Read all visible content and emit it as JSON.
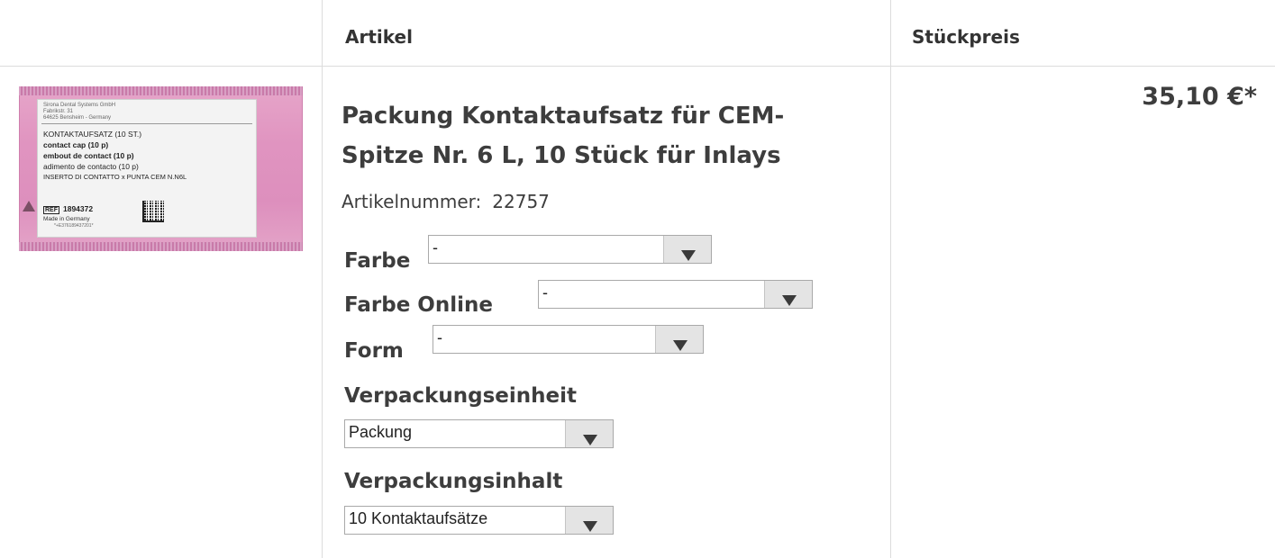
{
  "table": {
    "headers": {
      "article": "Artikel",
      "unit_price": "Stückpreis"
    }
  },
  "product": {
    "title": "Packung Kontaktaufsatz für CEM-Spitze Nr. 6 L, 10 Stück für Inlays",
    "article_number_label": "Artikelnummer:",
    "article_number": "22757",
    "price": "35,10 €*",
    "image": {
      "alt_icon": "product-package-photo",
      "label_lines": {
        "company": "Sirona Dental Systems GmbH",
        "street": "Fabrikstr. 31",
        "city": "64625 Bensheim - Germany",
        "line1": "KONTAKTAUFSATZ (10 ST.)",
        "line2": "contact cap (10 p)",
        "line3": "embout de contact (10 p)",
        "line4": "adimento de contacto (10 p)",
        "line5": "INSERTO DI CONTATTO x PUNTA CEM  N.N6L",
        "ref_tag": "REF",
        "ref_number": "1894372",
        "made_in": "Made in Germany",
        "barcode_text": "*+E376189437201*"
      }
    },
    "options": {
      "farbe": {
        "label": "Farbe",
        "value": "-"
      },
      "farbe_online": {
        "label": "Farbe Online",
        "value": "-"
      },
      "form": {
        "label": "Form",
        "value": "-"
      },
      "verpackungseinheit": {
        "label": "Verpackungseinheit",
        "value": "Packung"
      },
      "verpackungsinhalt": {
        "label": "Verpackungsinhalt",
        "value": "10 Kontaktaufsätze"
      }
    }
  },
  "icons": {
    "dropdown": "chevron-down-icon"
  }
}
